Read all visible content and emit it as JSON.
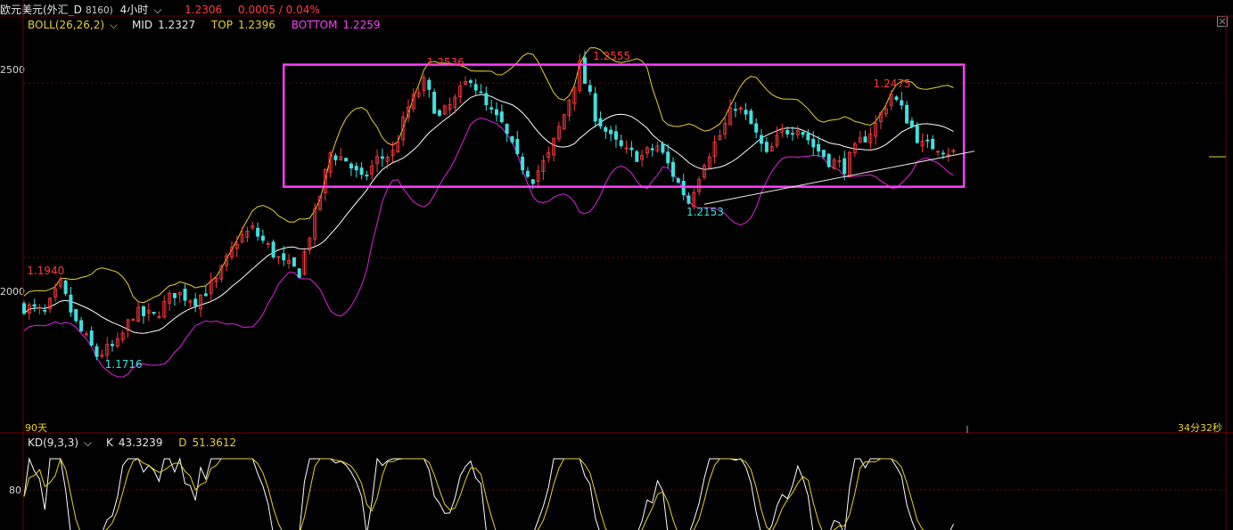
{
  "header": {
    "instrument": "欧元美元(外汇_D",
    "code": "8160)",
    "timeframe": "4小时",
    "price": "1.2306",
    "change": "0.0005 / 0.04%"
  },
  "boll": {
    "label": "BOLL(26,26,2)",
    "mid_label": "MID",
    "mid_value": "1.2327",
    "top_label": "TOP",
    "top_value": "1.2396",
    "bottom_label": "BOTTOM",
    "bottom_value": "1.2259"
  },
  "kd": {
    "label": "KD(9,3,3)",
    "k_label": "K",
    "k_value": "43.3239",
    "d_label": "D",
    "d_value": "51.3612"
  },
  "footer": {
    "left_label": "90天",
    "countdown": "34分32秒"
  },
  "colors": {
    "up": "#ff3b3b",
    "down": "#40e0e0",
    "mid": "#ffffff",
    "top": "#e8d030",
    "bottom": "#e020e0",
    "box": "#ff40ff",
    "grid": "#7a0000"
  },
  "chart_data": [
    {
      "type": "candlestick",
      "series": [
        {
          "name": "MID",
          "values_note": "Bollinger middle band"
        },
        {
          "name": "TOP",
          "values_note": "Bollinger upper band"
        },
        {
          "name": "BOTTOM",
          "values_note": "Bollinger lower band"
        }
      ],
      "ylim": [
        1.15,
        1.27
      ],
      "y_ticks": [
        {
          "value": 1.25,
          "label": "2500"
        },
        {
          "value": 1.2,
          "label": "2000"
        }
      ],
      "price_path": [
        [
          0,
          1.186
        ],
        [
          4,
          1.184
        ],
        [
          7,
          1.192
        ],
        [
          10,
          1.181
        ],
        [
          14,
          1.172
        ],
        [
          18,
          1.175
        ],
        [
          21,
          1.184
        ],
        [
          25,
          1.183
        ],
        [
          29,
          1.19
        ],
        [
          33,
          1.188
        ],
        [
          37,
          1.193
        ],
        [
          41,
          1.205
        ],
        [
          44,
          1.208
        ],
        [
          47,
          1.203
        ],
        [
          50,
          1.198
        ],
        [
          53,
          1.196
        ],
        [
          56,
          1.212
        ],
        [
          59,
          1.23
        ],
        [
          62,
          1.228
        ],
        [
          65,
          1.222
        ],
        [
          68,
          1.228
        ],
        [
          71,
          1.23
        ],
        [
          74,
          1.243
        ],
        [
          77,
          1.25
        ],
        [
          80,
          1.24
        ],
        [
          83,
          1.245
        ],
        [
          86,
          1.252
        ],
        [
          89,
          1.243
        ],
        [
          92,
          1.238
        ],
        [
          95,
          1.228
        ],
        [
          98,
          1.223
        ],
        [
          101,
          1.229
        ],
        [
          104,
          1.241
        ],
        [
          107,
          1.255
        ],
        [
          110,
          1.241
        ],
        [
          113,
          1.234
        ],
        [
          116,
          1.23
        ],
        [
          119,
          1.229
        ],
        [
          122,
          1.232
        ],
        [
          125,
          1.224
        ],
        [
          128,
          1.216
        ],
        [
          131,
          1.228
        ],
        [
          134,
          1.235
        ],
        [
          137,
          1.244
        ],
        [
          140,
          1.238
        ],
        [
          143,
          1.229
        ],
        [
          146,
          1.236
        ],
        [
          149,
          1.238
        ],
        [
          152,
          1.232
        ],
        [
          155,
          1.228
        ],
        [
          158,
          1.226
        ],
        [
          161,
          1.233
        ],
        [
          164,
          1.238
        ],
        [
          167,
          1.247
        ],
        [
          170,
          1.24
        ],
        [
          173,
          1.232
        ],
        [
          176,
          1.232
        ],
        [
          179,
          1.23
        ]
      ],
      "annotations": [
        {
          "text": "1.1940",
          "x": 4,
          "value": 1.194,
          "color": "up"
        },
        {
          "text": "1.1716",
          "x": 19,
          "value": 1.1716,
          "color": "down"
        },
        {
          "text": "1.2536",
          "x": 81,
          "value": 1.2536,
          "color": "up"
        },
        {
          "text": "1.2555",
          "x": 113,
          "value": 1.2555,
          "color": "up"
        },
        {
          "text": "1.2153",
          "x": 131,
          "value": 1.2153,
          "color": "down"
        },
        {
          "text": "1.2475",
          "x": 167,
          "value": 1.2475,
          "color": "up"
        }
      ],
      "rectangle": {
        "x_start": 50,
        "x_end": 181,
        "y_top": 1.2553,
        "y_bottom": 1.2203
      },
      "trendline": {
        "x_start": 131,
        "y_start": 1.2153,
        "x_end": 183,
        "y_end": 1.2305
      }
    },
    {
      "type": "line",
      "series": [
        {
          "name": "K",
          "values_note": "Stochastic K"
        },
        {
          "name": "D",
          "values_note": "Stochastic D"
        }
      ],
      "ylim": [
        0,
        100
      ],
      "y_ticks": [
        {
          "value": 80,
          "label": "80"
        }
      ]
    }
  ]
}
